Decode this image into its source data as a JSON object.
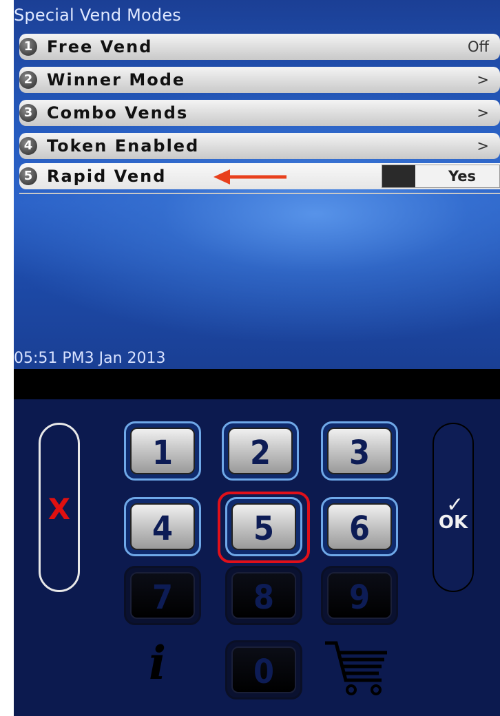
{
  "screen": {
    "title": "Special Vend Modes",
    "menu": [
      {
        "number": "1",
        "label": "Free Vend",
        "value": "Off"
      },
      {
        "number": "2",
        "label": "Winner Mode",
        "value": ">"
      },
      {
        "number": "3",
        "label": "Combo Vends",
        "value": ">"
      },
      {
        "number": "4",
        "label": "Token Enabled",
        "value": ">"
      },
      {
        "number": "5",
        "label": "Rapid Vend",
        "value": "Yes"
      }
    ],
    "datetime": "05:51 PM3 Jan 2013"
  },
  "keypad": {
    "cancel_label": "X",
    "ok_label": "OK",
    "keys": [
      "1",
      "2",
      "3",
      "4",
      "5",
      "6",
      "7",
      "8",
      "9",
      "0"
    ],
    "info_icon": "info-icon",
    "cart_icon": "cart-icon"
  },
  "colors": {
    "annotation_arrow": "#e8401c",
    "highlight_box": "#e0101a",
    "cancel_x": "#e01010",
    "keypad_background": "#0c1a4f"
  }
}
